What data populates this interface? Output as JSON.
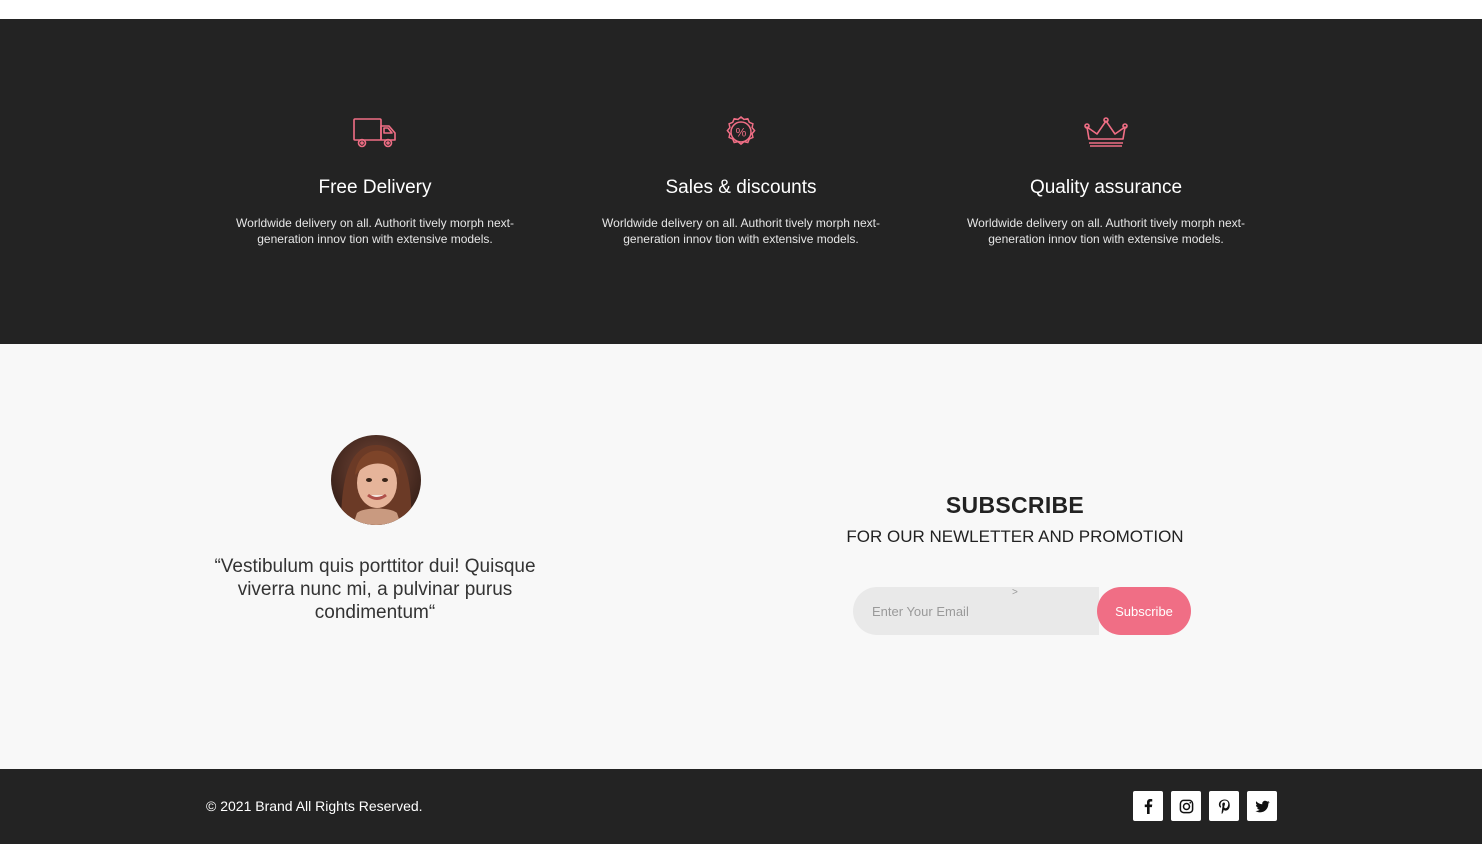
{
  "features": [
    {
      "icon": "delivery-truck-icon",
      "title": "Free Delivery",
      "description_line1": "Worldwide delivery on all. Authorit tively morph next-",
      "description_line2": "generation innov tion with extensive models."
    },
    {
      "icon": "percent-badge-icon",
      "title": "Sales & discounts",
      "description_line1": "Worldwide delivery on all. Authorit tively morph next-",
      "description_line2": "generation innov tion with extensive models."
    },
    {
      "icon": "crown-icon",
      "title": "Quality assurance",
      "description_line1": "Worldwide delivery on all. Authorit tively morph next-",
      "description_line2": "generation innov tion with extensive models."
    }
  ],
  "testimonial": {
    "quote_line1": "“Vestibulum quis porttitor dui! Quisque",
    "quote_line2": "viverra nunc mi, a pulvinar purus",
    "quote_line3": "condimentum“"
  },
  "subscribe": {
    "title": "SUBSCRIBE",
    "subtitle": "FOR OUR NEWLETTER AND PROMOTION",
    "input_placeholder": "Enter Your Email",
    "input_value": "",
    "caret_text": ">",
    "button_label": "Subscribe"
  },
  "footer": {
    "copyright": "© 2021 Brand All Rights Reserved.",
    "social_icons": [
      "facebook-icon",
      "instagram-icon",
      "pinterest-icon",
      "twitter-icon"
    ]
  },
  "colors": {
    "accent": "#f06e85",
    "dark_bg": "#232323",
    "light_bg": "#f8f8f8"
  }
}
